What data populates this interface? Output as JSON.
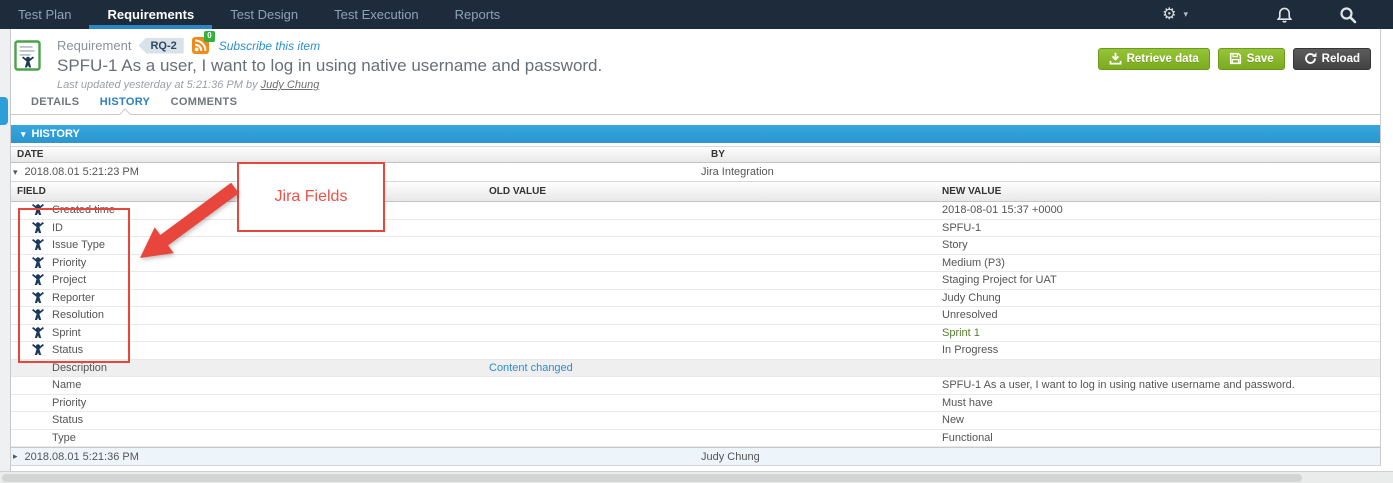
{
  "nav": {
    "items": [
      "Test Plan",
      "Requirements",
      "Test Design",
      "Test Execution",
      "Reports"
    ],
    "active": "Requirements"
  },
  "icons": {
    "gear": "⚙",
    "caret": "▾",
    "expand_down": "▾",
    "collapse_right": "▸"
  },
  "header": {
    "type_label": "Requirement",
    "id_badge": "RQ-2",
    "rss_count": "0",
    "subscribe_label": "Subscribe this item",
    "title": "SPFU-1 As a user, I want to log in using native username and password.",
    "last_updated_prefix": "Last updated yesterday at 5:21:36 PM by ",
    "last_updated_by": "Judy Chung",
    "buttons": {
      "retrieve": "Retrieve data",
      "save": "Save",
      "reload": "Reload"
    }
  },
  "tabs": {
    "details": "DETAILS",
    "history": "HISTORY",
    "comments": "COMMENTS",
    "active": "HISTORY"
  },
  "history": {
    "panel_title": "HISTORY",
    "columns": {
      "date": "DATE",
      "by": "BY"
    },
    "field_columns": {
      "field": "FIELD",
      "old": "OLD VALUE",
      "new": "NEW VALUE"
    },
    "entries": [
      {
        "date": "2018.08.01 5:21:23 PM",
        "by": "Jira Integration",
        "expanded": true,
        "changes": [
          {
            "field": "Created time",
            "jira": true,
            "old": "",
            "new": "2018-08-01 15:37 +0000"
          },
          {
            "field": "ID",
            "jira": true,
            "old": "",
            "new": "SPFU-1"
          },
          {
            "field": "Issue Type",
            "jira": true,
            "old": "",
            "new": "Story"
          },
          {
            "field": "Priority",
            "jira": true,
            "old": "",
            "new": "Medium (P3)"
          },
          {
            "field": "Project",
            "jira": true,
            "old": "",
            "new": "Staging Project for UAT"
          },
          {
            "field": "Reporter",
            "jira": true,
            "old": "",
            "new": "Judy Chung"
          },
          {
            "field": "Resolution",
            "jira": true,
            "old": "",
            "new": "Unresolved"
          },
          {
            "field": "Sprint",
            "jira": true,
            "old": "",
            "new": "Sprint 1",
            "new_color": "green"
          },
          {
            "field": "Status",
            "jira": true,
            "old": "",
            "new": "In Progress"
          },
          {
            "field": "Description",
            "jira": false,
            "old_link": "Content changed",
            "new": "",
            "shaded": true
          },
          {
            "field": "Name",
            "jira": false,
            "old": "",
            "new": "SPFU-1 As a user, I want to log in using native username and password."
          },
          {
            "field": "Priority",
            "jira": false,
            "old": "",
            "new": "Must have"
          },
          {
            "field": "Status",
            "jira": false,
            "old": "",
            "new": "New"
          },
          {
            "field": "Type",
            "jira": false,
            "old": "",
            "new": "Functional"
          }
        ]
      },
      {
        "date": "2018.08.01 5:21:36 PM",
        "by": "Judy Chung",
        "expanded": false
      }
    ]
  },
  "annotation": {
    "label": "Jira Fields"
  },
  "colors": {
    "nav_bg": "#1E2B3B",
    "accent_blue": "#2F9FD7",
    "link_blue": "#2E8CC9",
    "button_green": "#85B526",
    "button_dark": "#4A4A4A",
    "annotation_red": "#E8463C",
    "sprint_green": "#557F2D",
    "jira_icon_navy": "#1B3A5C"
  }
}
